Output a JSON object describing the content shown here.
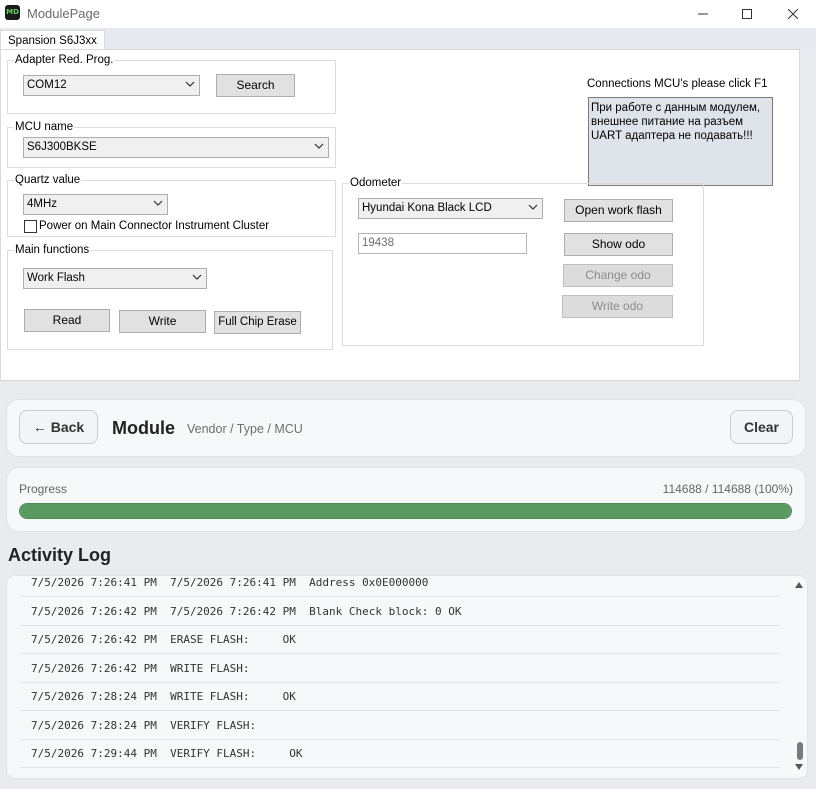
{
  "window": {
    "title": "ModulePage",
    "icon_text": "MD",
    "controls": [
      "minimize-icon",
      "maximize-icon",
      "close-icon"
    ]
  },
  "tabs": [
    {
      "label": "Spansion S6J3xx",
      "active": true
    }
  ],
  "adapter": {
    "group_label": "Adapter Red. Prog.",
    "port_value": "COM12",
    "search_label": "Search"
  },
  "mcu": {
    "group_label": "MCU name",
    "value": "S6J300BKSE"
  },
  "quartz": {
    "group_label": "Quartz value",
    "value": "4MHz",
    "power_checkbox_label": "Power on Main Connector Instrument Cluster",
    "power_checked": false
  },
  "main_functions": {
    "group_label": "Main functions",
    "mode_value": "Work Flash",
    "read_label": "Read",
    "write_label": "Write",
    "erase_label": "Full Chip Erase"
  },
  "connections": {
    "label": "Connections MCU's please click F1",
    "notice": "При работе с данным модулем, внешнее питание на разъем UART адаптера не подавать!!!"
  },
  "odometer": {
    "group_label": "Odometer",
    "model_value": "Hyundai Kona Black LCD",
    "odo_value": "19438",
    "open_flash_label": "Open work flash",
    "show_odo_label": "Show odo",
    "change_odo_label": "Change odo",
    "write_odo_label": "Write odo",
    "change_odo_enabled": false,
    "write_odo_enabled": false
  },
  "module_bar": {
    "back_label": "← Back",
    "title": "Module",
    "subtitle": "Vendor / Type / MCU",
    "clear_label": "Clear"
  },
  "progress": {
    "label": "Progress",
    "count_text": "114688 / 114688 (100%)",
    "fraction": 1.0
  },
  "log": {
    "title": "Activity Log",
    "entries": [
      "7/5/2026 7:26:41 PM  7/5/2026 7:26:41 PM  Address 0x0E000000",
      "7/5/2026 7:26:42 PM  7/5/2026 7:26:42 PM  Blank Check block: 0 OK",
      "7/5/2026 7:26:42 PM  ERASE FLASH:     OK",
      "7/5/2026 7:26:42 PM  WRITE FLASH:",
      "7/5/2026 7:28:24 PM  WRITE FLASH:     OK",
      "7/5/2026 7:28:24 PM  VERIFY FLASH:",
      "7/5/2026 7:29:44 PM  VERIFY FLASH:     OK"
    ]
  },
  "colors": {
    "progress_fill": "#5a9a60",
    "notice_bg": "#dfe3ea"
  }
}
